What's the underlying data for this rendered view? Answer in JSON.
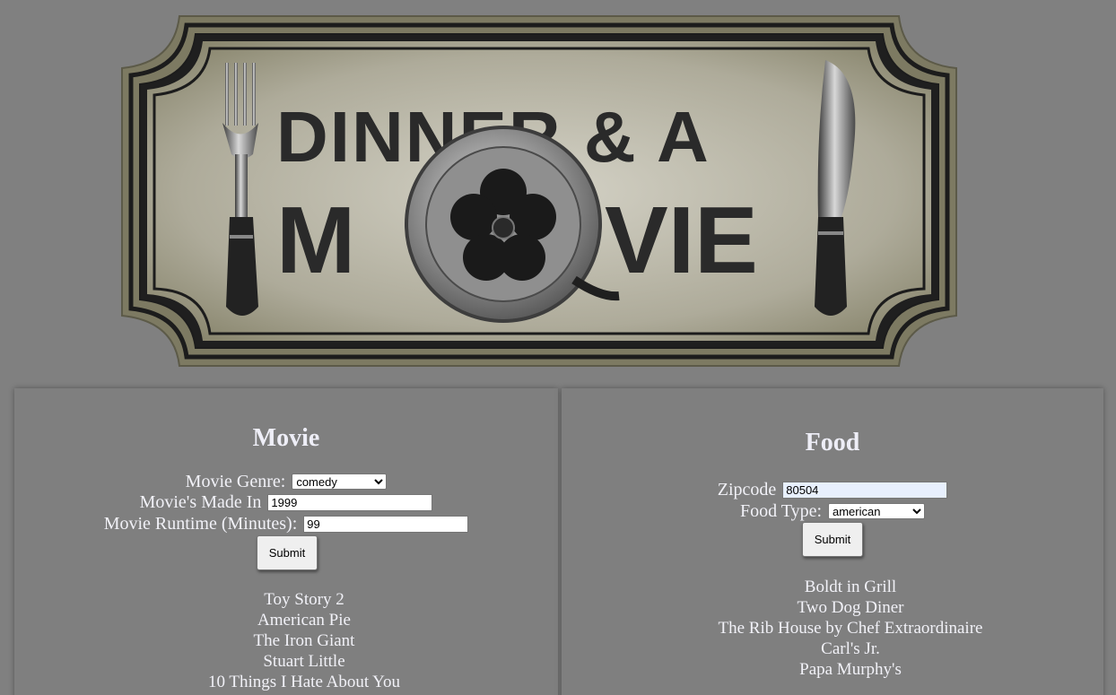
{
  "logo": {
    "line1": "DINNER & A",
    "line2_left": "M",
    "line2_right": "VIE"
  },
  "movie": {
    "heading": "Movie",
    "genre_label": "Movie Genre:",
    "genre_value": "comedy",
    "genre_options": [
      "comedy"
    ],
    "year_label": "Movie's Made In",
    "year_value": "1999",
    "runtime_label": "Movie Runtime (Minutes):",
    "runtime_value": "99",
    "submit_label": "Submit",
    "results": [
      "Toy Story 2",
      "American Pie",
      "The Iron Giant",
      "Stuart Little",
      "10 Things I Hate About You"
    ]
  },
  "food": {
    "heading": "Food",
    "zip_label": "Zipcode",
    "zip_value": "80504",
    "type_label": "Food Type:",
    "type_value": "american",
    "type_options": [
      "american"
    ],
    "submit_label": "Submit",
    "results": [
      "Boldt in Grill",
      "Two Dog Diner",
      "The Rib House by Chef Extraordinaire",
      "Carl's Jr.",
      "Papa Murphy's"
    ]
  }
}
